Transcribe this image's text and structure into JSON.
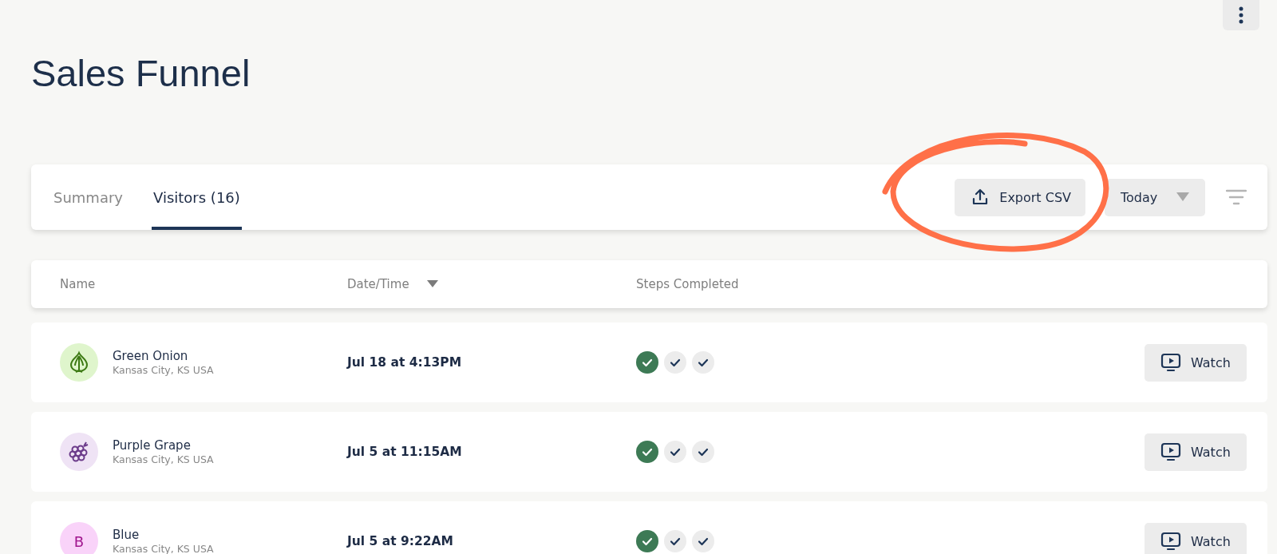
{
  "title": "Sales Funnel",
  "tabs": [
    {
      "label": "Summary",
      "selected": false
    },
    {
      "label": "Visitors (16)",
      "selected": true
    }
  ],
  "export_button": "Export CSV",
  "range_dropdown": "Today",
  "table": {
    "columns": [
      {
        "label": "Name",
        "sorted": false
      },
      {
        "label": "Date/Time",
        "sorted": true
      },
      {
        "label": "Steps Completed",
        "sorted": false
      }
    ],
    "rows": [
      {
        "name": "Green Onion",
        "location": "Kansas City, KS USA",
        "avatar": {
          "kind": "onion",
          "color": "#dff5cc"
        },
        "datetime": "Jul 18 at 4:13PM",
        "steps": [
          {
            "completed": true
          },
          {
            "completed": false
          },
          {
            "completed": false
          }
        ],
        "action": "Watch"
      },
      {
        "name": "Purple Grape",
        "location": "Kansas City, KS USA",
        "avatar": {
          "kind": "grape",
          "color": "#efe3f5"
        },
        "datetime": "Jul 5 at 11:15AM",
        "steps": [
          {
            "completed": true
          },
          {
            "completed": false
          },
          {
            "completed": false
          }
        ],
        "action": "Watch"
      },
      {
        "name": "Blue",
        "location": "Kansas City, KS USA",
        "avatar": {
          "kind": "letter",
          "letter": "B",
          "color": "#f9d3f9"
        },
        "datetime": "Jul 5 at 9:22AM",
        "steps": [
          {
            "completed": true
          },
          {
            "completed": false
          },
          {
            "completed": false
          }
        ],
        "action": "Watch"
      }
    ]
  }
}
